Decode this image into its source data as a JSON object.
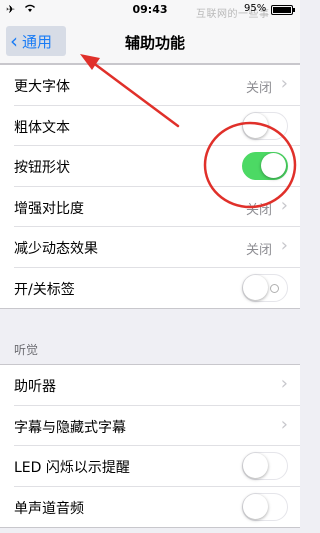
{
  "status_bar": {
    "time": "09:43",
    "watermark": "互联网的一些事",
    "battery_percent": "95%",
    "battery_level": 0.95
  },
  "nav": {
    "back_label": "通用",
    "title": "辅助功能"
  },
  "section_vision": {
    "rows": [
      {
        "label": "更大字体",
        "value": "关闭"
      },
      {
        "label": "粗体文本",
        "toggle": false
      },
      {
        "label": "按钮形状",
        "toggle": true
      },
      {
        "label": "增强对比度",
        "value": "关闭"
      },
      {
        "label": "减少动态效果",
        "value": "关闭"
      },
      {
        "label": "开/关标签",
        "toggle": false
      }
    ]
  },
  "section_hearing": {
    "header": "听觉",
    "rows": [
      {
        "label": "助听器"
      },
      {
        "label": "字幕与隐藏式字幕"
      },
      {
        "label": "LED 闪烁以示提醒",
        "toggle": false
      },
      {
        "label": "单声道音频",
        "toggle": false
      }
    ]
  },
  "colors": {
    "accent": "#1a7cf5",
    "toggle_on": "#4cd964",
    "annotation": "#e0302a"
  }
}
